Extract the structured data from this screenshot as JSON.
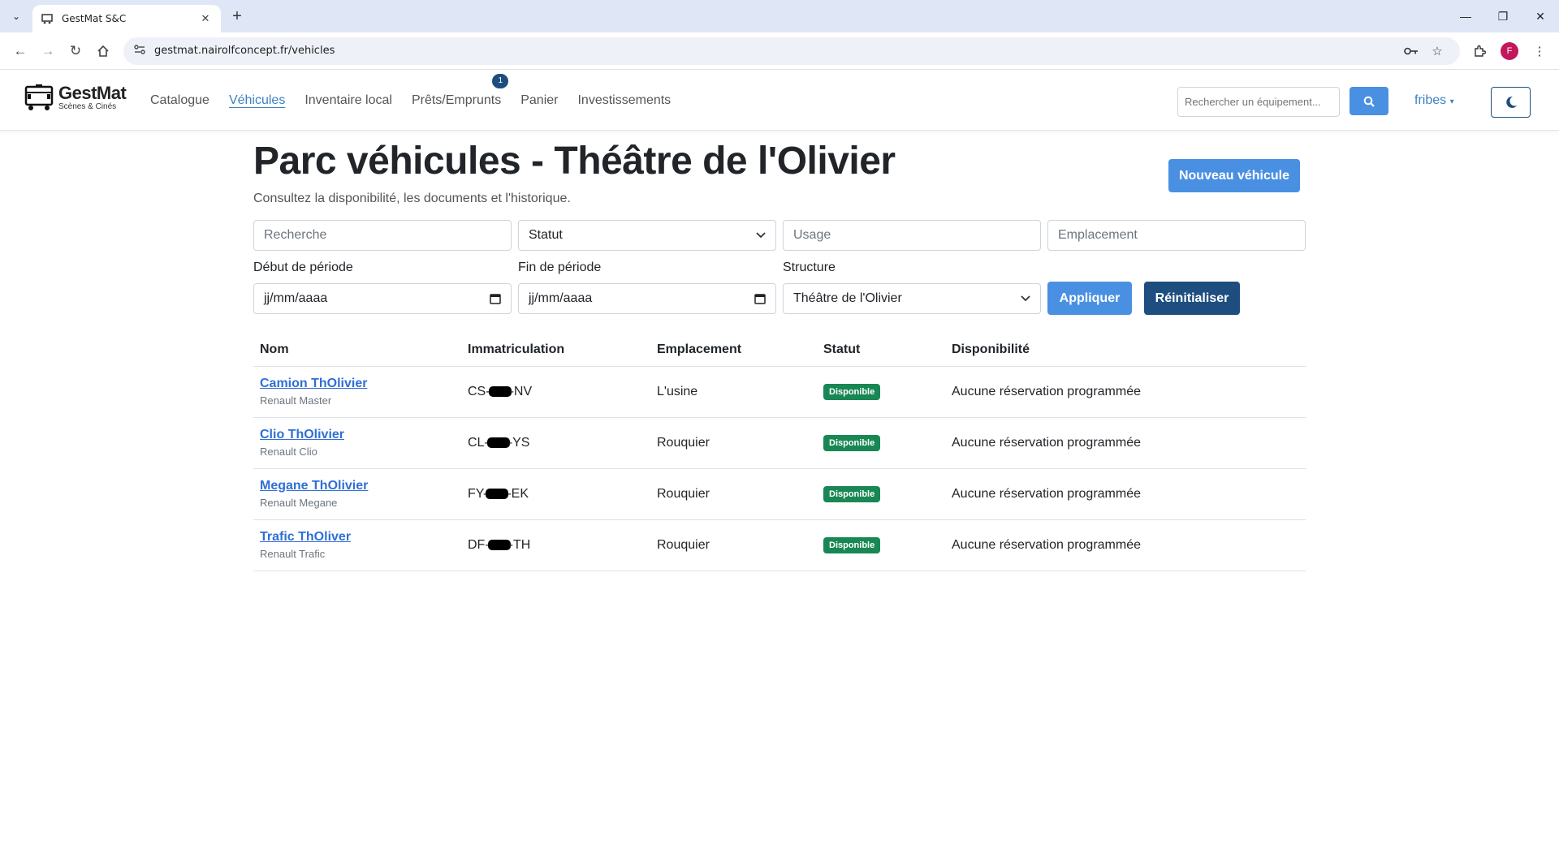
{
  "browser": {
    "tab_title": "GestMat S&C",
    "url": "gestmat.nairolfconcept.fr/vehicles",
    "profile_initial": "F"
  },
  "nav": {
    "brand_name": "GestMat",
    "brand_sub": "Scènes & Cinés",
    "links": [
      "Catalogue",
      "Véhicules",
      "Inventaire local",
      "Prêts/Emprunts",
      "Panier",
      "Investissements"
    ],
    "active_link": "Véhicules",
    "cart_badge": "1",
    "search_placeholder": "Rechercher un équipement...",
    "user": "fribes"
  },
  "page": {
    "title": "Parc véhicules - Théâtre de l'Olivier",
    "subtitle": "Consultez la disponibilité, les documents et l'historique.",
    "new_button": "Nouveau véhicule"
  },
  "filters": {
    "search_placeholder": "Recherche",
    "status_select": "Statut",
    "usage_placeholder": "Usage",
    "location_placeholder": "Emplacement",
    "start_label": "Début de période",
    "start_value": "jj/mm/aaaa",
    "end_label": "Fin de période",
    "end_value": "jj/mm/aaaa",
    "structure_label": "Structure",
    "structure_value": "Théâtre de l'Olivier",
    "apply": "Appliquer",
    "reset": "Réinitialiser"
  },
  "table": {
    "headers": [
      "Nom",
      "Immatriculation",
      "Emplacement",
      "Statut",
      "Disponibilité"
    ],
    "rows": [
      {
        "name": "Camion ThOlivier",
        "model": "Renault Master",
        "plate_pre": "CS-",
        "plate_post": "-NV",
        "location": "L'usine",
        "status": "Disponible",
        "availability": "Aucune réservation programmée"
      },
      {
        "name": "Clio ThOlivier",
        "model": "Renault Clio",
        "plate_pre": "CL-",
        "plate_post": "-YS",
        "location": "Rouquier",
        "status": "Disponible",
        "availability": "Aucune réservation programmée"
      },
      {
        "name": "Megane ThOlivier",
        "model": "Renault Megane",
        "plate_pre": "FY-",
        "plate_post": "-EK",
        "location": "Rouquier",
        "status": "Disponible",
        "availability": "Aucune réservation programmée"
      },
      {
        "name": "Trafic ThOliver",
        "model": "Renault Trafic",
        "plate_pre": "DF-",
        "plate_post": "-TH",
        "location": "Rouquier",
        "status": "Disponible",
        "availability": "Aucune réservation programmée"
      }
    ]
  }
}
